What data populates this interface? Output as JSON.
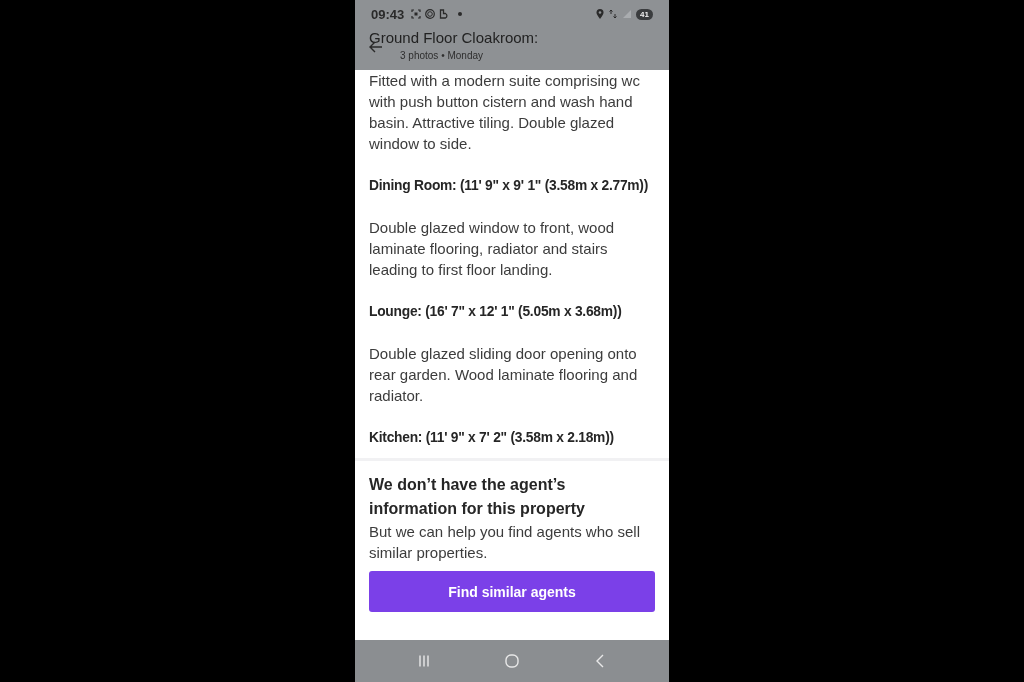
{
  "status_bar": {
    "time": "09:43",
    "battery": "41"
  },
  "header": {
    "title": "Ground Floor Cloakroom:",
    "subtitle": "3 photos • Monday"
  },
  "description": [
    {
      "kind": "paragraph",
      "text": "Fitted with a modern suite comprising wc with push button cistern and wash hand basin. Attractive tiling. Double glazed window to side."
    },
    {
      "kind": "heading",
      "text": "Dining Room: (11' 9\" x 9' 1\" (3.58m x 2.77m))"
    },
    {
      "kind": "paragraph",
      "text": "Double glazed window to front, wood laminate flooring, radiator and stairs leading to first floor landing."
    },
    {
      "kind": "heading",
      "text": "Lounge: (16' 7\" x 12' 1\" (5.05m x 3.68m))"
    },
    {
      "kind": "paragraph",
      "text": "Double glazed sliding door opening onto rear garden. Wood laminate flooring and radiator."
    },
    {
      "kind": "heading",
      "text": "Kitchen: (11' 9\" x 7' 2\" (3.58m x 2.18m))"
    }
  ],
  "agent_card": {
    "title": "We don’t have the agent’s information for this property",
    "text": "But we can help you find agents who sell similar properties.",
    "button": "Find similar agents"
  }
}
